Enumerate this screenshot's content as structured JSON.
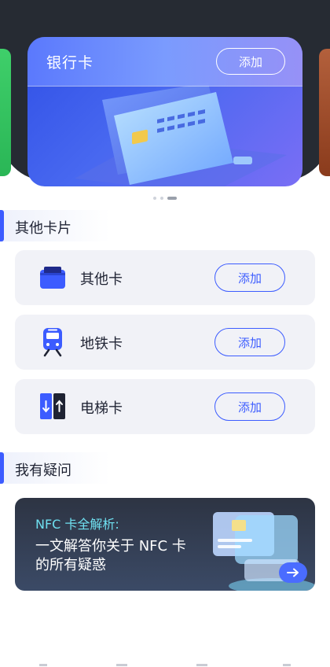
{
  "carousel": {
    "bank_card_title": "银行卡",
    "bank_card_add": "添加",
    "page_count": 3,
    "active_page": 3
  },
  "other_cards": {
    "heading": "其他卡片",
    "items": [
      {
        "label": "其他卡",
        "icon": "wallet-card-icon",
        "add": "添加"
      },
      {
        "label": "地铁卡",
        "icon": "metro-train-icon",
        "add": "添加"
      },
      {
        "label": "电梯卡",
        "icon": "elevator-icon",
        "add": "添加"
      }
    ]
  },
  "faq": {
    "heading": "我有疑问",
    "banner_subtitle": "NFC 卡全解析:",
    "banner_title": "一文解答你关于 NFC 卡的所有疑惑",
    "arrow_icon": "arrow-right-icon"
  },
  "colors": {
    "accent": "#3c5cff",
    "top_bg": "#262b33",
    "card_bg": "#f1f2f7",
    "faq_subtitle": "#6fe0f0"
  }
}
